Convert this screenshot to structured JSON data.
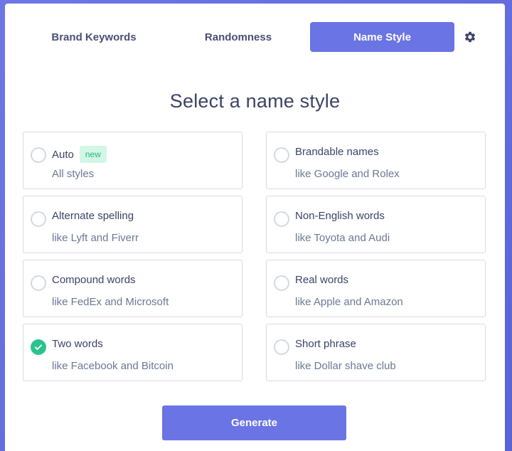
{
  "tabs": [
    {
      "label": "Brand Keywords",
      "active": false
    },
    {
      "label": "Randomness",
      "active": false
    },
    {
      "label": "Name Style",
      "active": true
    }
  ],
  "settings_icon": "gear-icon",
  "heading": "Select a name style",
  "options": [
    {
      "title": "Auto",
      "badge": "new",
      "subtitle": "All styles",
      "selected": false
    },
    {
      "title": "Brandable names",
      "subtitle": "like Google and Rolex",
      "selected": false
    },
    {
      "title": "Alternate spelling",
      "subtitle": "like Lyft and Fiverr",
      "selected": false
    },
    {
      "title": "Non-English words",
      "subtitle": "like Toyota and Audi",
      "selected": false
    },
    {
      "title": "Compound words",
      "subtitle": "like FedEx and Microsoft",
      "selected": false
    },
    {
      "title": "Real words",
      "subtitle": "like Apple and Amazon",
      "selected": false
    },
    {
      "title": "Two words",
      "subtitle": "like Facebook and Bitcoin",
      "selected": true
    },
    {
      "title": "Short phrase",
      "subtitle": "like Dollar shave club",
      "selected": false
    }
  ],
  "generate_label": "Generate",
  "colors": {
    "accent": "#6b74e4",
    "selected": "#2bc28e",
    "badge_bg": "#d2f6e7",
    "badge_text": "#28b97f",
    "text": "#3d4266",
    "muted": "#6b7894"
  }
}
